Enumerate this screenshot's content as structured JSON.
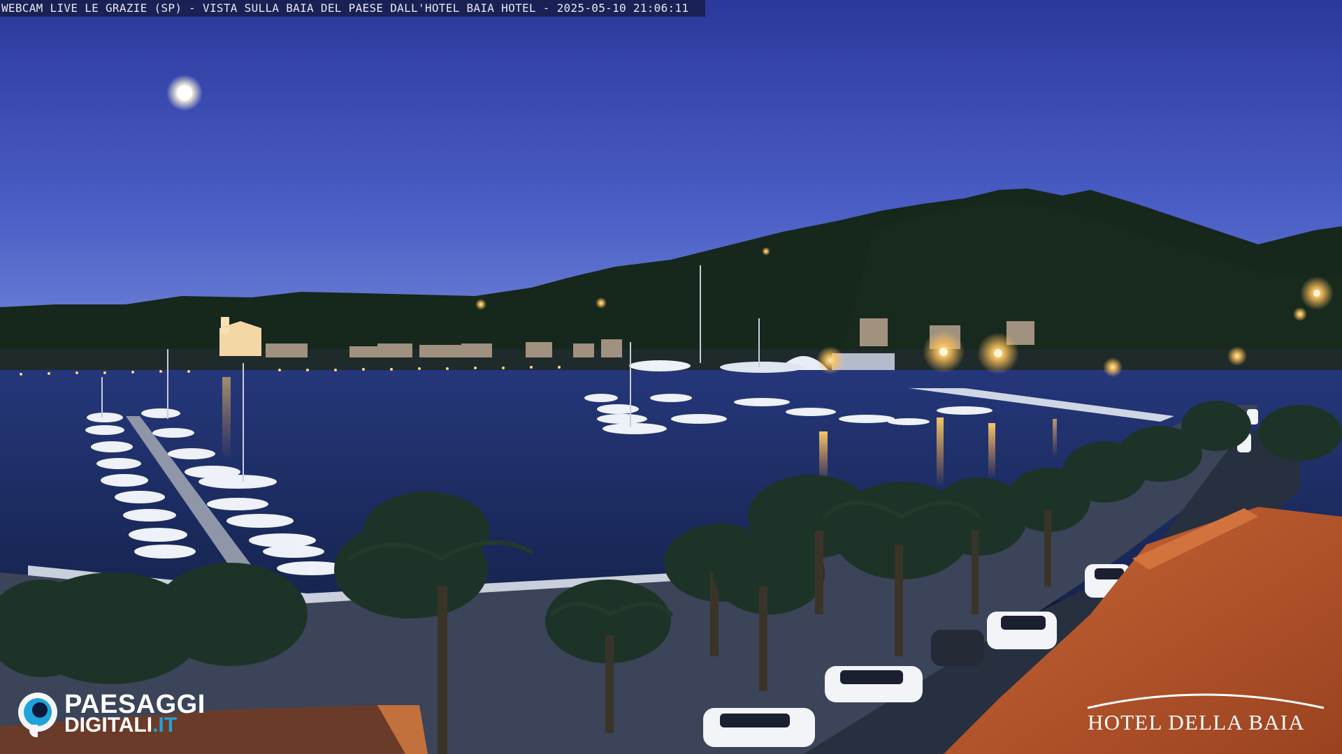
{
  "overlay": {
    "caption": "WEBCAM LIVE LE GRAZIE (SP) - VISTA SULLA BAIA DEL PAESE DALL'HOTEL BAIA HOTEL - 2025-05-10 21:06:11"
  },
  "logos": {
    "left_line1": "PAESAGGI",
    "left_line2_main": "DIGITALI",
    "left_line2_accent": ".IT",
    "right_text": "HOTEL DELLA BAIA"
  },
  "colors": {
    "sky_top": "#2a3a9e",
    "sky_horizon": "#6f87d9",
    "water": "#1d2f6a",
    "accent_logo": "#1fa3da",
    "lamp_glow": "#ffc25a",
    "roof": "#b5562c"
  },
  "icons": {
    "left_logo": "eye-logo-icon",
    "moon": "moon-icon"
  }
}
